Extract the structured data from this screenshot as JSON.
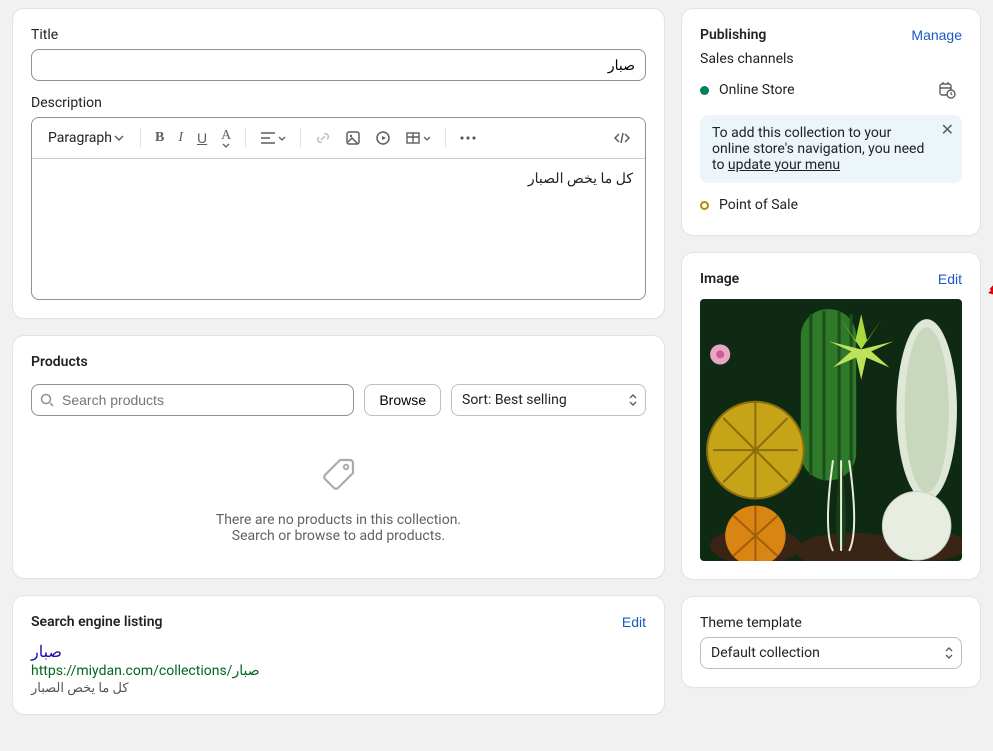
{
  "title_card": {
    "title_label": "Title",
    "title_value": "صبار",
    "description_label": "Description",
    "paragraph_btn": "Paragraph",
    "description_value": "كل ما يخص الصبار"
  },
  "products_card": {
    "heading": "Products",
    "search_placeholder": "Search products",
    "browse_label": "Browse",
    "sort_prefix": "Sort: ",
    "sort_value": "Best selling",
    "empty_line1": "There are no products in this collection.",
    "empty_line2": "Search or browse to add products."
  },
  "seo_card": {
    "heading": "Search engine listing",
    "edit_label": "Edit",
    "title": "صبار",
    "url": "https://miydan.com/collections/صبار",
    "description": "كل ما يخص الصبار"
  },
  "publishing": {
    "heading": "Publishing",
    "manage_label": "Manage",
    "channels_label": "Sales channels",
    "online_store": "Online Store",
    "point_of_sale": "Point of Sale",
    "info_text_1": "To add this collection to your online store's navigation, you need to ",
    "info_link": "update your menu"
  },
  "image_card": {
    "heading": "Image",
    "edit_label": "Edit"
  },
  "theme_card": {
    "heading": "Theme template",
    "value": "Default collection"
  }
}
